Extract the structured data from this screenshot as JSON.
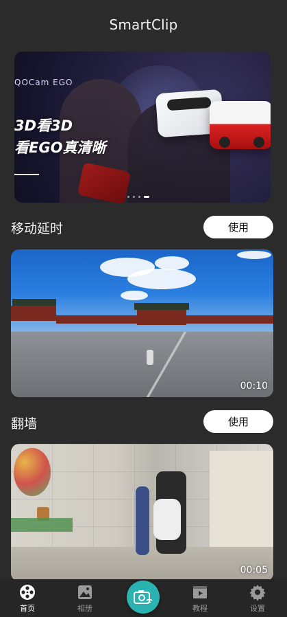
{
  "header": {
    "title": "SmartClip"
  },
  "banner": {
    "brand": "QOCam EGO",
    "headline_line1": "3D看3D",
    "headline_line2": "看EGO真清晰",
    "page_count": 4,
    "active_index": 3
  },
  "sections": [
    {
      "title": "移动延时",
      "button_label": "使用",
      "duration": "00:10"
    },
    {
      "title": "翻墙",
      "button_label": "使用",
      "duration": "00:05"
    }
  ],
  "tabbar": {
    "items": [
      {
        "label": "首页",
        "icon": "film-reel-icon",
        "active": true
      },
      {
        "label": "相册",
        "icon": "photo-album-icon",
        "active": false
      },
      {
        "label": "",
        "icon": "camera-wifi-icon",
        "active": false
      },
      {
        "label": "教程",
        "icon": "video-tutorial-icon",
        "active": false
      },
      {
        "label": "设置",
        "icon": "gear-icon",
        "active": false
      }
    ]
  },
  "colors": {
    "background": "#2b2b2b",
    "accent": "#2ab3b0",
    "button_bg": "#ffffff"
  }
}
